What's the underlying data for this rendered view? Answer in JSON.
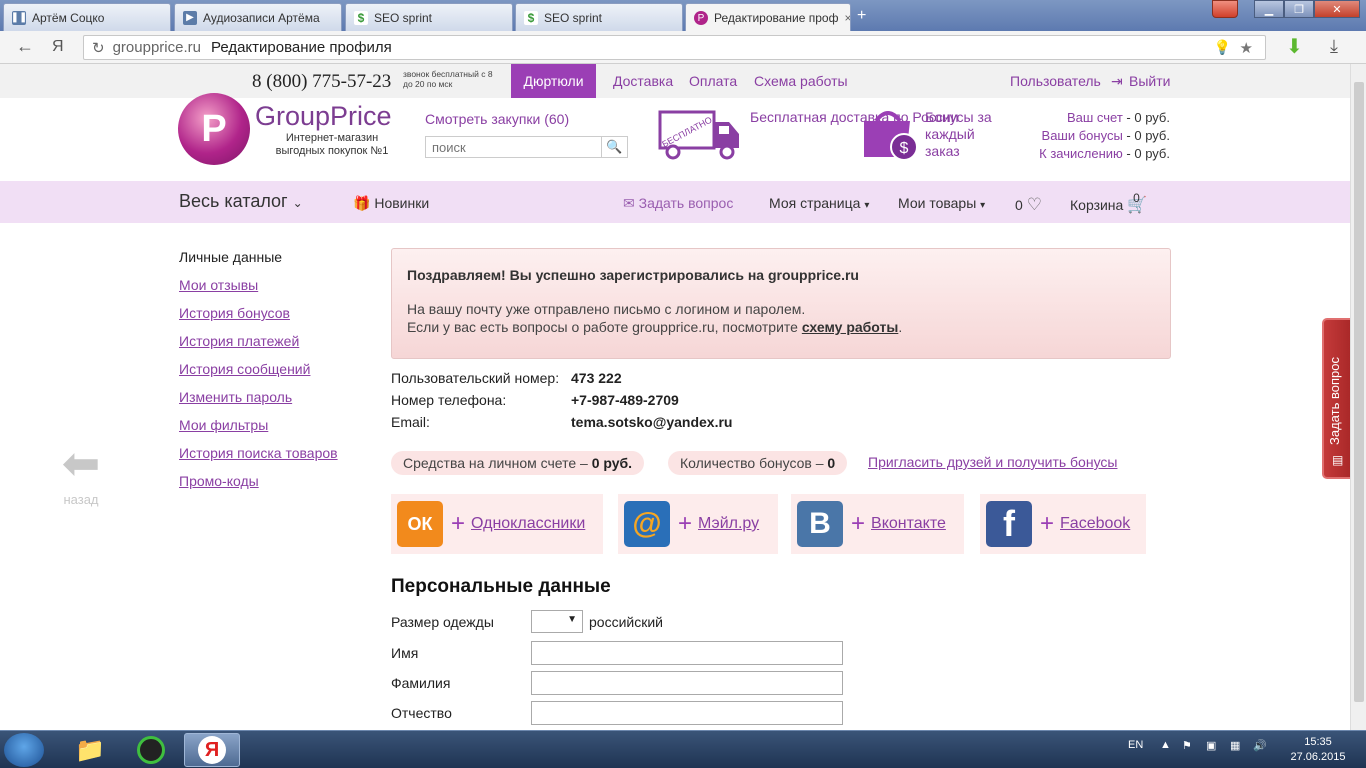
{
  "browser": {
    "tabs": [
      {
        "label": "Артём Соцко",
        "icon": "pause-icon"
      },
      {
        "label": "Аудиозаписи Артёма",
        "icon": "play-icon"
      },
      {
        "label": "SEO sprint",
        "icon": "dollar-icon"
      },
      {
        "label": "SEO sprint",
        "icon": "dollar-icon"
      },
      {
        "label": "Редактирование проф",
        "icon": "groupprice-icon"
      }
    ],
    "tab_close": "×",
    "new_tab": "+",
    "url_domain": "groupprice.ru",
    "page_title": "Редактирование профиля",
    "yandex_logo": "Я"
  },
  "topbar": {
    "phone": "8 (800) 775-57-23",
    "phone_note": "звонок бесплатный с 8 до 20 по мск",
    "dl_button": "Дюртюли",
    "links": [
      "Доставка",
      "Оплата",
      "Схема работы"
    ],
    "user": "Пользователь",
    "logout": "Выйти"
  },
  "header": {
    "logo_letter": "P",
    "logo_name": "GroupPrice",
    "logo_tagline": "Интернет-магазин выгодных покупок №1",
    "view_purchases": "Смотреть закупки (60)",
    "search_placeholder": "поиск",
    "truck_label": "БЕСПЛАТНО",
    "free_delivery": "Бесплатная доставка по России",
    "bonus_promo": "Бонусы за каждый заказ",
    "account": {
      "balance_label": "Ваш счет",
      "balance": "- 0 руб.",
      "bonuses_label": "Ваши бонусы",
      "bonuses": "- 0 руб.",
      "pending_label": "К зачислению",
      "pending": "- 0 руб."
    }
  },
  "nav": {
    "catalog": "Весь каталог",
    "new": "Новинки",
    "ask": "Задать вопрос",
    "my_page": "Моя страница",
    "my_goods": "Мои товары",
    "fav_count": "0",
    "cart": "Корзина",
    "cart_count": "0"
  },
  "sidebar": {
    "items": [
      "Личные данные",
      "Мои отзывы",
      "История бонусов",
      "История платежей",
      "История сообщений",
      "Изменить пароль",
      "Мои фильтры",
      "История поиска товаров",
      "Промо-коды"
    ],
    "back": "назад"
  },
  "notice": {
    "title": "Поздравляем! Вы успешно зарегистрировались на groupprice.ru",
    "line1": "На вашу почту уже отправлено письмо с логином и паролем.",
    "line2": "Если у вас есть вопросы о работе groupprice.ru, посмотрите",
    "link": "схему работы",
    "dot": "."
  },
  "profile": {
    "user_number_label": "Пользовательский номер:",
    "user_number": "473 222",
    "phone_label": "Номер телефона:",
    "phone": "+7-987-489-2709",
    "email_label": "Email:",
    "email": "tema.sotsko@yandex.ru"
  },
  "balances": {
    "account_label": "Средства на личном счете –",
    "account_value": "0 руб.",
    "bonus_label": "Количество бонусов –",
    "bonus_value": "0",
    "invite": "Пригласить друзей и получить бонусы"
  },
  "social": [
    {
      "name": "Одноклассники",
      "glyph": "ОК",
      "color": "#f28a1c"
    },
    {
      "name": "Мэйл.ру",
      "glyph": "@",
      "color": "#2a6fb8"
    },
    {
      "name": "Вконтакте",
      "glyph": "B",
      "color": "#4a76a8"
    },
    {
      "name": "Facebook",
      "glyph": "f",
      "color": "#3b5998"
    }
  ],
  "personal": {
    "heading": "Персональные данные",
    "size_label": "Размер одежды",
    "size_note": "российский",
    "first_name": "Имя",
    "last_name": "Фамилия",
    "patronymic": "Отчество"
  },
  "side_tab": "Задать вопрос",
  "taskbar": {
    "lang": "EN",
    "time": "15:35",
    "date": "27.06.2015"
  },
  "colors": {
    "brand": "#9b3fb5",
    "link": "#8a3fa3",
    "nav_bg": "#f1dff5",
    "notice_bg": "#f6d6d6"
  }
}
